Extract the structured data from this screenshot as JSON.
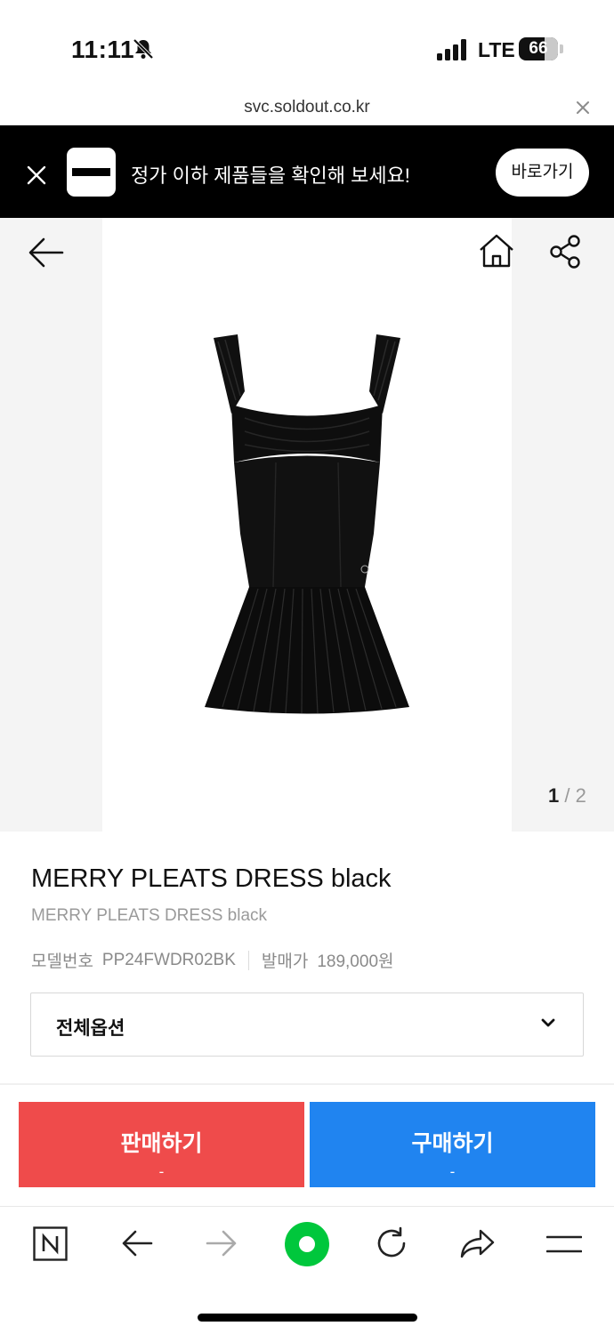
{
  "status_bar": {
    "time": "11:11",
    "network": "LTE",
    "battery": "66"
  },
  "url_bar": {
    "url": "svc.soldout.co.kr"
  },
  "promo": {
    "text": "정가 이하 제품들을 확인해 보세요!",
    "button": "바로가기"
  },
  "gallery": {
    "current": "1",
    "separator": "/",
    "total": "2"
  },
  "product": {
    "title": "MERRY PLEATS DRESS black",
    "subtitle": "MERRY PLEATS DRESS black",
    "model_label": "모델번호",
    "model_value": "PP24FWDR02BK",
    "price_label": "발매가",
    "price_value": "189,000원"
  },
  "options": {
    "selected": "전체옵션"
  },
  "actions": {
    "sell_label": "판매하기",
    "sell_price": "-",
    "buy_label": "구매하기",
    "buy_price": "-"
  },
  "colors": {
    "sell": "#ef4b4b",
    "buy": "#2084f0",
    "banner": "#000000",
    "green_button": "#00c73c"
  },
  "toolbar_icons": [
    "naver-n-icon",
    "back-arrow-icon",
    "forward-arrow-icon",
    "green-dot-icon",
    "refresh-icon",
    "share-icon",
    "menu-icon"
  ]
}
